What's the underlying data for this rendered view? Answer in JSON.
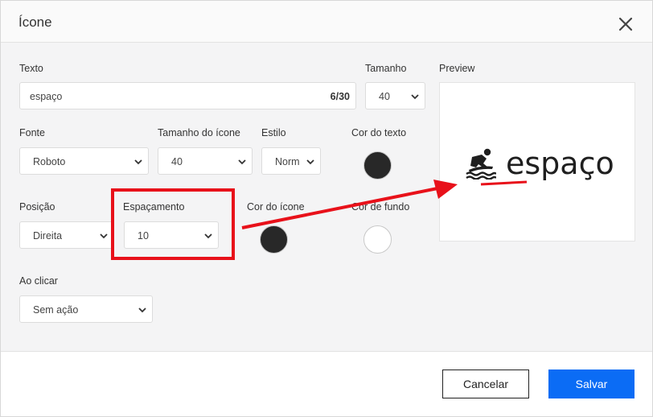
{
  "dialog": {
    "title": "Ícone"
  },
  "form": {
    "text": {
      "label": "Texto",
      "value": "espaço",
      "counter": "6/30"
    },
    "size": {
      "label": "Tamanho",
      "value": "40"
    },
    "font": {
      "label": "Fonte",
      "value": "Roboto"
    },
    "icon_size": {
      "label": "Tamanho do ícone",
      "value": "40"
    },
    "style": {
      "label": "Estilo",
      "value": "Norm"
    },
    "text_color": {
      "label": "Cor do texto",
      "color": "#282828"
    },
    "position": {
      "label": "Posição",
      "value": "Direita"
    },
    "spacing": {
      "label": "Espaçamento",
      "value": "10"
    },
    "icon_color": {
      "label": "Cor do ícone",
      "color": "#282828"
    },
    "background_color": {
      "label": "Cor de fundo",
      "color": "#ffffff"
    },
    "on_click": {
      "label": "Ao clicar",
      "value": "Sem ação"
    }
  },
  "preview": {
    "label": "Preview",
    "text": "espaço",
    "icon": "surfing-icon"
  },
  "footer": {
    "cancel_label": "Cancelar",
    "save_label": "Salvar"
  },
  "colors": {
    "primary": "#0b6cf5",
    "annotation": "#e8111a",
    "swatch_dark": "#282828"
  }
}
